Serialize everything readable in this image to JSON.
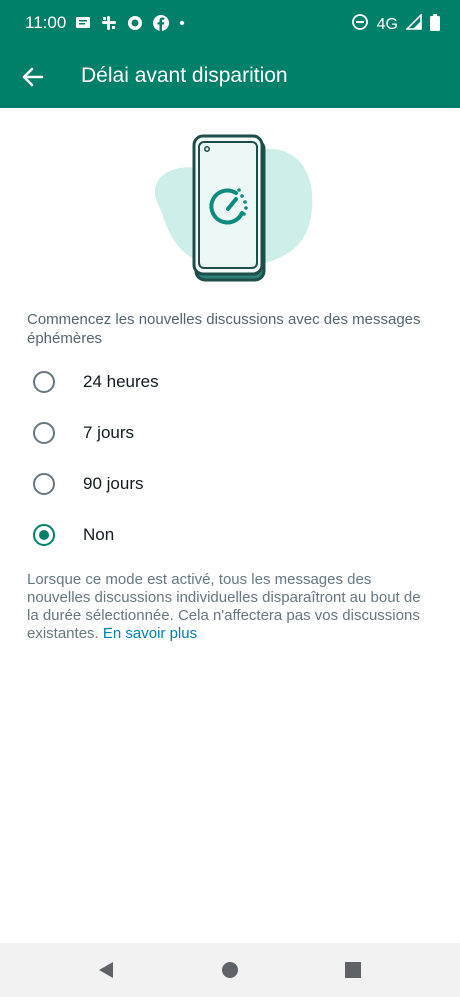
{
  "status_bar": {
    "time": "11:00",
    "network": "4G",
    "left_icons": [
      "message-icon",
      "slack-icon",
      "app-icon",
      "facebook-icon",
      "dot-icon"
    ],
    "right_icons": [
      "do-not-disturb-icon",
      "signal-icon",
      "battery-icon"
    ]
  },
  "app_bar": {
    "title": "Délai avant disparition",
    "color": "#008069"
  },
  "intro_text": "Commencez les nouvelles discussions avec des messages éphémères",
  "options": [
    {
      "label": "24 heures",
      "selected": false
    },
    {
      "label": "7 jours",
      "selected": false
    },
    {
      "label": "90 jours",
      "selected": false
    },
    {
      "label": "Non",
      "selected": true
    }
  ],
  "footer": {
    "text": "Lorsque ce mode est activé, tous les messages des nouvelles discussions individuelles disparaîtront au bout de la durée sélectionnée. Cela n'affectera pas vos discussions existantes.",
    "link": "En savoir plus"
  },
  "accent_color": "#008069",
  "link_color": "#027eb5"
}
